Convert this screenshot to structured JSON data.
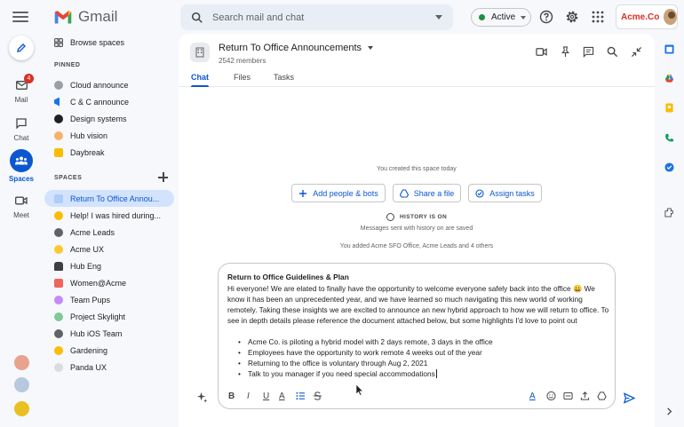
{
  "app": {
    "name": "Gmail"
  },
  "search": {
    "placeholder": "Search mail and chat"
  },
  "status": {
    "label": "Active",
    "color": "#1e8e3e"
  },
  "account": {
    "brand": "Acme.Co"
  },
  "rail": {
    "items": [
      {
        "label": "Mail",
        "icon": "mail-icon",
        "badge": "4"
      },
      {
        "label": "Chat",
        "icon": "chat-icon"
      },
      {
        "label": "Spaces",
        "icon": "spaces-icon",
        "active": true
      },
      {
        "label": "Meet",
        "icon": "meet-icon"
      }
    ]
  },
  "sidebar": {
    "browse": "Browse spaces",
    "pinned_header": "PINNED",
    "pinned": [
      {
        "label": "Cloud announce",
        "icon": "globe-icon"
      },
      {
        "label": "C & C announce",
        "icon": "megaphone-icon"
      },
      {
        "label": "Design systems",
        "icon": "design-icon"
      },
      {
        "label": "Hub vision",
        "icon": "vision-icon"
      },
      {
        "label": "Daybreak",
        "icon": "daybreak-icon"
      }
    ],
    "spaces_header": "SPACES",
    "spaces": [
      {
        "label": "Return To Office Annou...",
        "icon": "office-icon",
        "selected": true
      },
      {
        "label": "Help! I was hired during...",
        "icon": "emoji-icon"
      },
      {
        "label": "Acme Leads",
        "icon": "leads-icon"
      },
      {
        "label": "Acme UX",
        "icon": "smiley-icon"
      },
      {
        "label": "Hub Eng",
        "icon": "eng-icon"
      },
      {
        "label": "Women@Acme",
        "icon": "women-icon"
      },
      {
        "label": "Team Pups",
        "icon": "pups-icon"
      },
      {
        "label": "Project Skylight",
        "icon": "skylight-icon"
      },
      {
        "label": "Hub iOS Team",
        "icon": "ios-icon"
      },
      {
        "label": "Gardening",
        "icon": "gardening-icon"
      },
      {
        "label": "Panda UX",
        "icon": "panda-icon"
      }
    ]
  },
  "space": {
    "title": "Return To Office Announcements",
    "members": "2542 members",
    "tabs": [
      "Chat",
      "Files",
      "Tasks"
    ]
  },
  "timeline": {
    "created": "You created this space today",
    "actions": [
      "Add people & bots",
      "Share a file",
      "Assign tasks"
    ],
    "history_on": "HISTORY IS ON",
    "history_note": "Messages sent with history on are saved",
    "added": "You added Acme SFO Office, Acme Leads and 4 others"
  },
  "composer": {
    "title": "Return to Office Guidelines & Plan",
    "body": "Hi everyone! We are elated to finally have the opportunity to welcome everyone safely back into the office 😀 We know it has been an unprecedented year, and we have learned so much navigating this new world of working remotely. Taking these insights we are excited to announce an new hybrid approach to how we will return to office. To see in depth details please reference the document attached below, but some highlights I'd love to point out",
    "bullets": [
      "Acme Co. is piloting a hybrid model with 2 days remote, 3 days in the office",
      "Employees have the opportunity to work remote 4 weeks out of the year",
      "Returning to the office is voluntary through Aug 2, 2021",
      "Talk to you manager if you need special accommodations"
    ],
    "format": {
      "bold": "B",
      "italic": "I",
      "underline": "U",
      "color": "A"
    }
  }
}
